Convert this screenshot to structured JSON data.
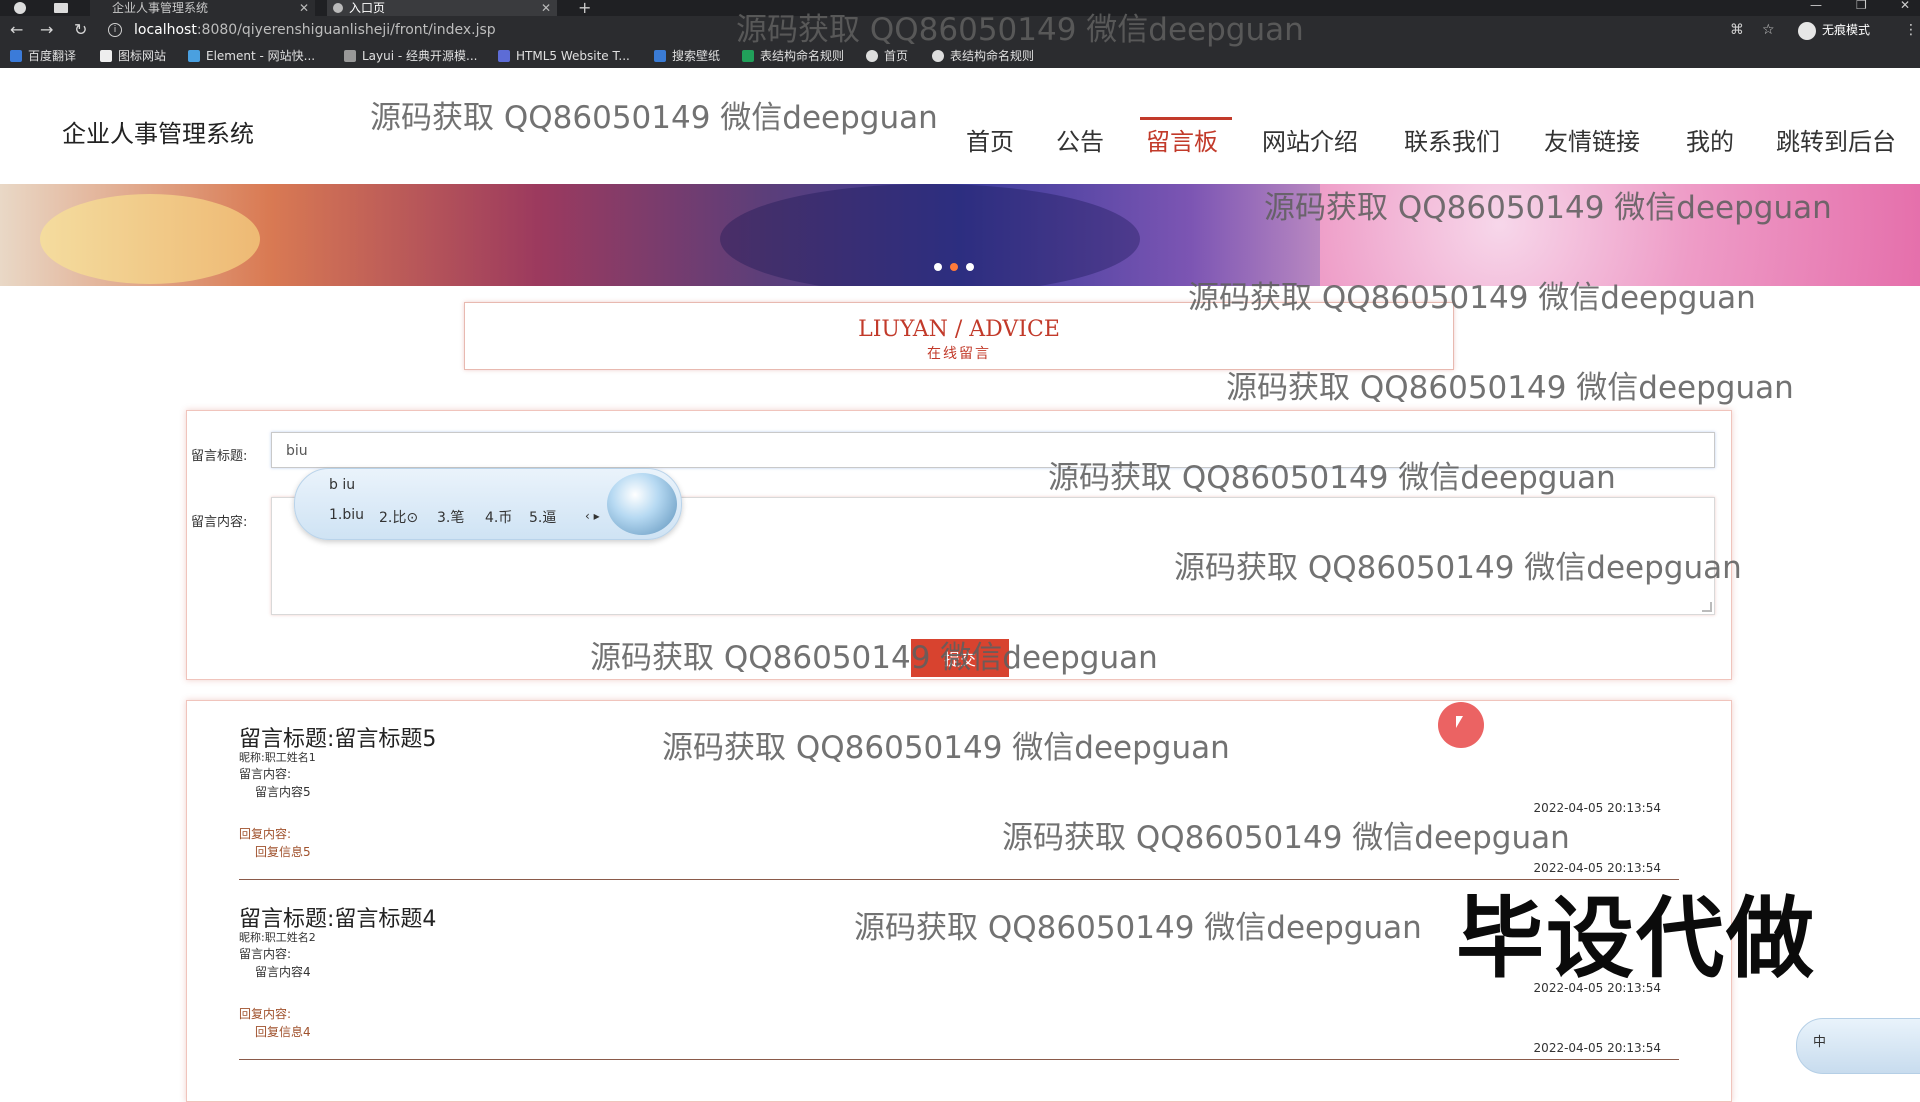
{
  "browser": {
    "tabs": [
      {
        "title": "企业人事管理系统",
        "active": false
      },
      {
        "title": "入口页",
        "active": true
      }
    ],
    "url_host": "localhost",
    "url_rest": ":8080/qiyerenshiguanlisheji/front/index.jsp",
    "incognito_label": "无痕模式",
    "bookmarks": [
      "百度翻译",
      "图标网站",
      "Element - 网站快...",
      "Layui - 经典开源模...",
      "HTML5 Website T...",
      "搜索壁纸",
      "表结构命名规则",
      "首页",
      "表结构命名规则"
    ]
  },
  "site": {
    "logo": "企业人事管理系统",
    "nav": [
      "首页",
      "公告",
      "留言板",
      "网站介绍",
      "联系我们",
      "友情链接",
      "我的",
      "跳转到后台"
    ],
    "active_nav": "留言板",
    "accent_color": "#c23a2a"
  },
  "section": {
    "title_en": "LIUYAN / ADVICE",
    "title_cn": "在线留言"
  },
  "form": {
    "title_label": "留言标题:",
    "title_value": "biu",
    "content_label": "留言内容:",
    "submit_label": "提交"
  },
  "ime": {
    "composition": "b iu",
    "candidates": [
      "1.biu",
      "2.比⊙",
      "3.笔",
      "4.币",
      "5.逼"
    ],
    "mini_label": "中"
  },
  "messages": [
    {
      "title_label": "留言标题:",
      "title": "留言标题5",
      "nickname": "昵称:职工姓名1",
      "content_label": "留言内容:",
      "content": "留言内容5",
      "time1": "2022-04-05 20:13:54",
      "reply_label": "回复内容:",
      "reply": "回复信息5",
      "time2": "2022-04-05 20:13:54"
    },
    {
      "title_label": "留言标题:",
      "title": "留言标题4",
      "nickname": "昵称:职工姓名2",
      "content_label": "留言内容:",
      "content": "留言内容4",
      "time1": "2022-04-05 20:13:54",
      "reply_label": "回复内容:",
      "reply": "回复信息4",
      "time2": "2022-04-05 20:13:54"
    }
  ],
  "overlay": {
    "watermark": "源码获取 QQ86050149 微信deepguan",
    "big_text": "毕设代做"
  }
}
